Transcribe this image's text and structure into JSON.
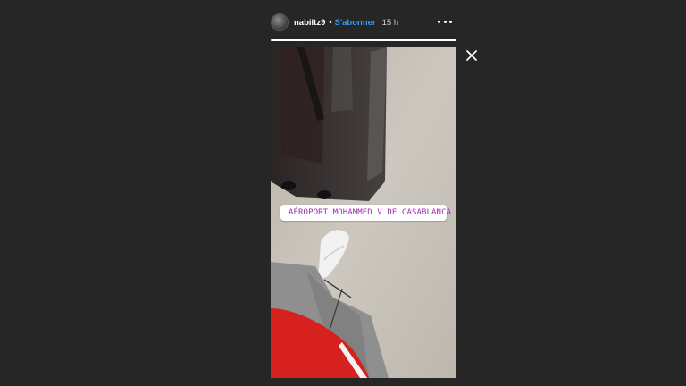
{
  "story": {
    "username": "nabiltz9",
    "separator": "•",
    "follow_label": "S'abonner",
    "time_ago": "15 h",
    "progress": 1.0,
    "location_sticker": "AÉROPORT MOHAMMED V DE CASABLANCA"
  },
  "icons": {
    "more": "more-horizontal-icon",
    "close": "close-icon",
    "location": "location-pin-icon"
  },
  "colors": {
    "background": "#262626",
    "follow_link": "#3897f0",
    "location_text": "#9b2fae"
  }
}
